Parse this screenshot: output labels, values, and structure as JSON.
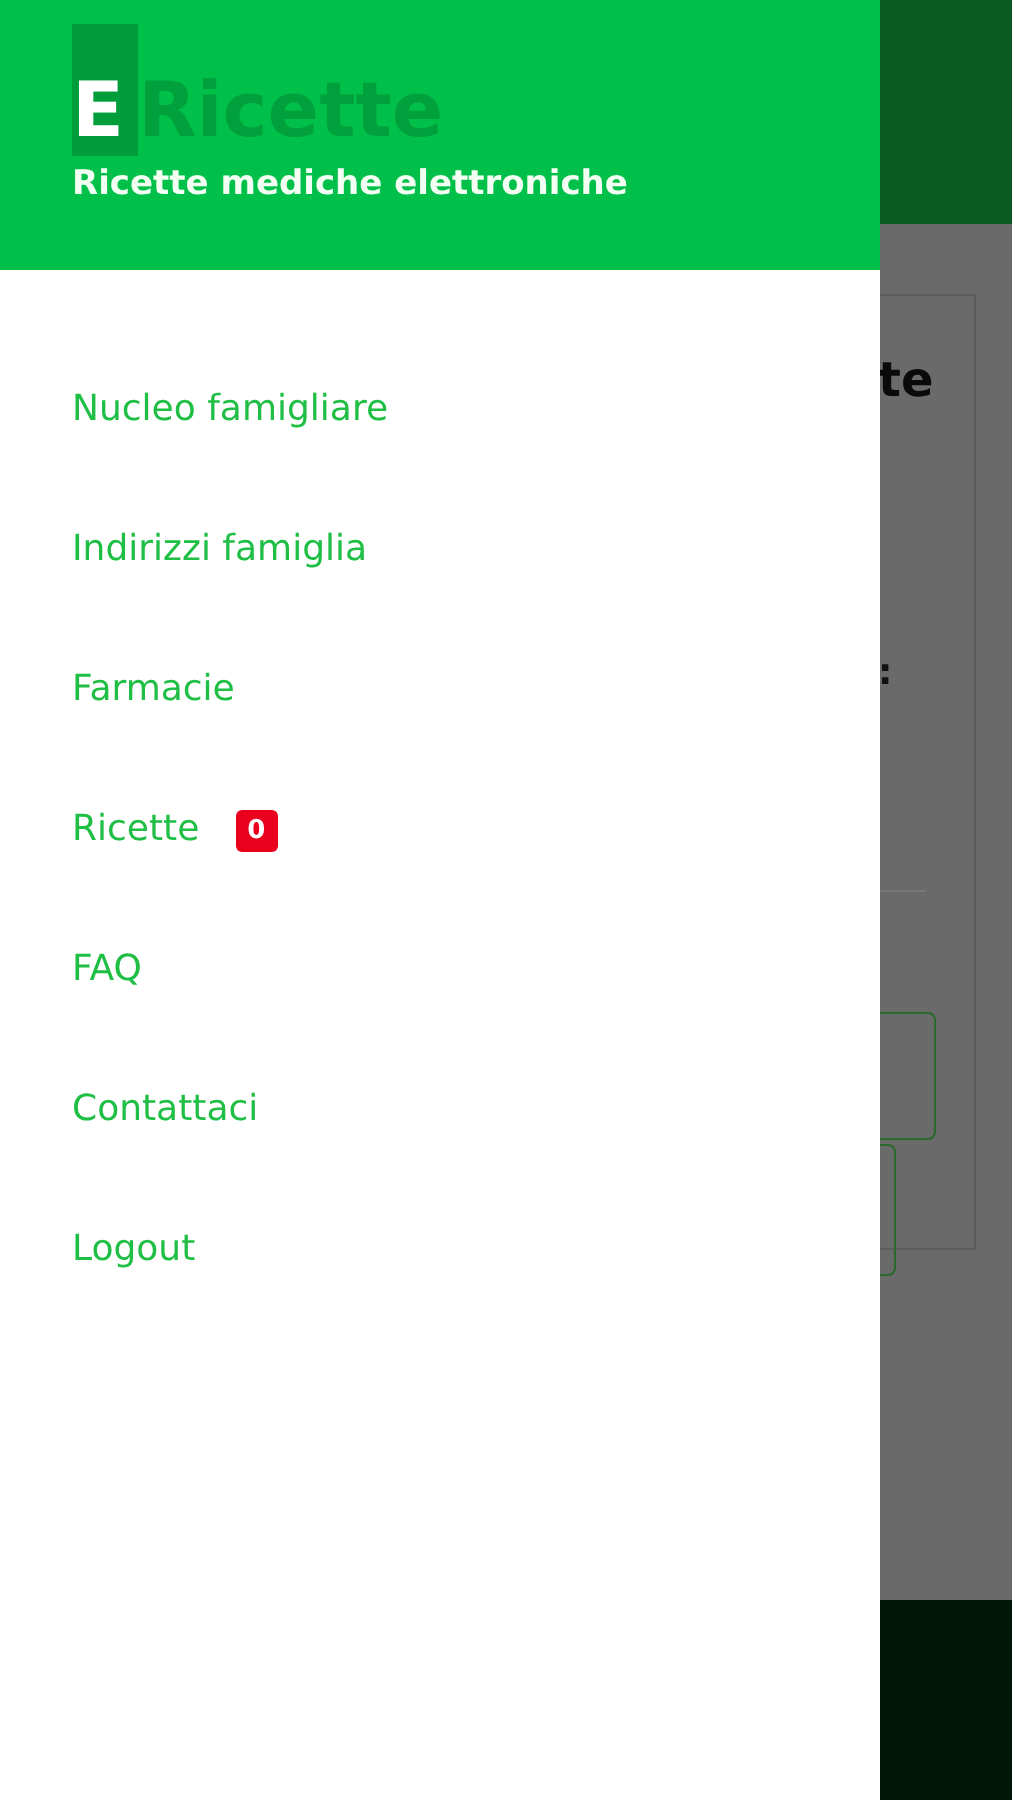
{
  "background": {
    "heading_fragment": "te",
    "label_fragment": ":"
  },
  "drawer": {
    "logo": {
      "mark": "E",
      "name": "Ricette"
    },
    "subtitle": "Ricette mediche elettroniche",
    "items": [
      {
        "label": "Nucleo famigliare"
      },
      {
        "label": "Indirizzi famiglia"
      },
      {
        "label": "Farmacie"
      },
      {
        "label": "Ricette",
        "badge": "0"
      },
      {
        "label": "FAQ"
      },
      {
        "label": "Contattaci"
      },
      {
        "label": "Logout"
      }
    ]
  }
}
